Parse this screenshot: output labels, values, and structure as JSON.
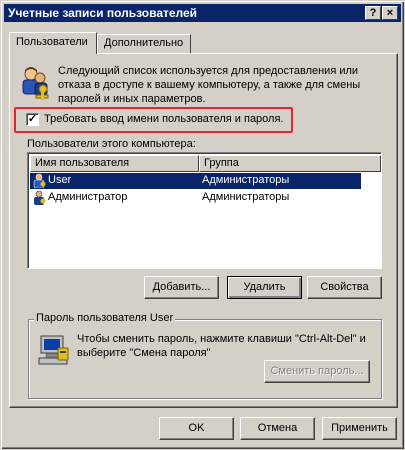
{
  "window": {
    "title": "Учетные записи пользователей"
  },
  "titlebar": {
    "help_glyph": "?",
    "close_glyph": "×"
  },
  "tabs": [
    {
      "label": "Пользователи",
      "active": true
    },
    {
      "label": "Дополнительно",
      "active": false
    }
  ],
  "intro_text": "Следующий список используется для предоставления или отказа в доступе к вашему компьютеру, а также для смены паролей и иных параметров.",
  "require_login": {
    "label": "Требовать ввод имени пользователя и пароля.",
    "checked": true,
    "mark": "✓"
  },
  "users_section": {
    "label": "Пользователи этого компьютера:",
    "columns": [
      "Имя пользователя",
      "Группа"
    ],
    "rows": [
      {
        "name": "User",
        "group": "Администраторы",
        "selected": true
      },
      {
        "name": "Администратор",
        "group": "Администраторы",
        "selected": false
      }
    ]
  },
  "user_buttons": {
    "add": "Добавить...",
    "remove": "Удалить",
    "properties": "Свойства"
  },
  "password_group": {
    "title": "Пароль пользователя User",
    "text": "Чтобы сменить пароль, нажмите клавиши \"Ctrl-Alt-Del\" и выберите \"Смена пароля\"",
    "button": "Сменить пароль..."
  },
  "dialog_buttons": {
    "ok": "OK",
    "cancel": "Отмена",
    "apply": "Применить"
  },
  "colors": {
    "titlebar": "#0a246a",
    "face": "#d4d0c8",
    "highlight_border": "#e2282a",
    "selection": "#0a246a"
  }
}
